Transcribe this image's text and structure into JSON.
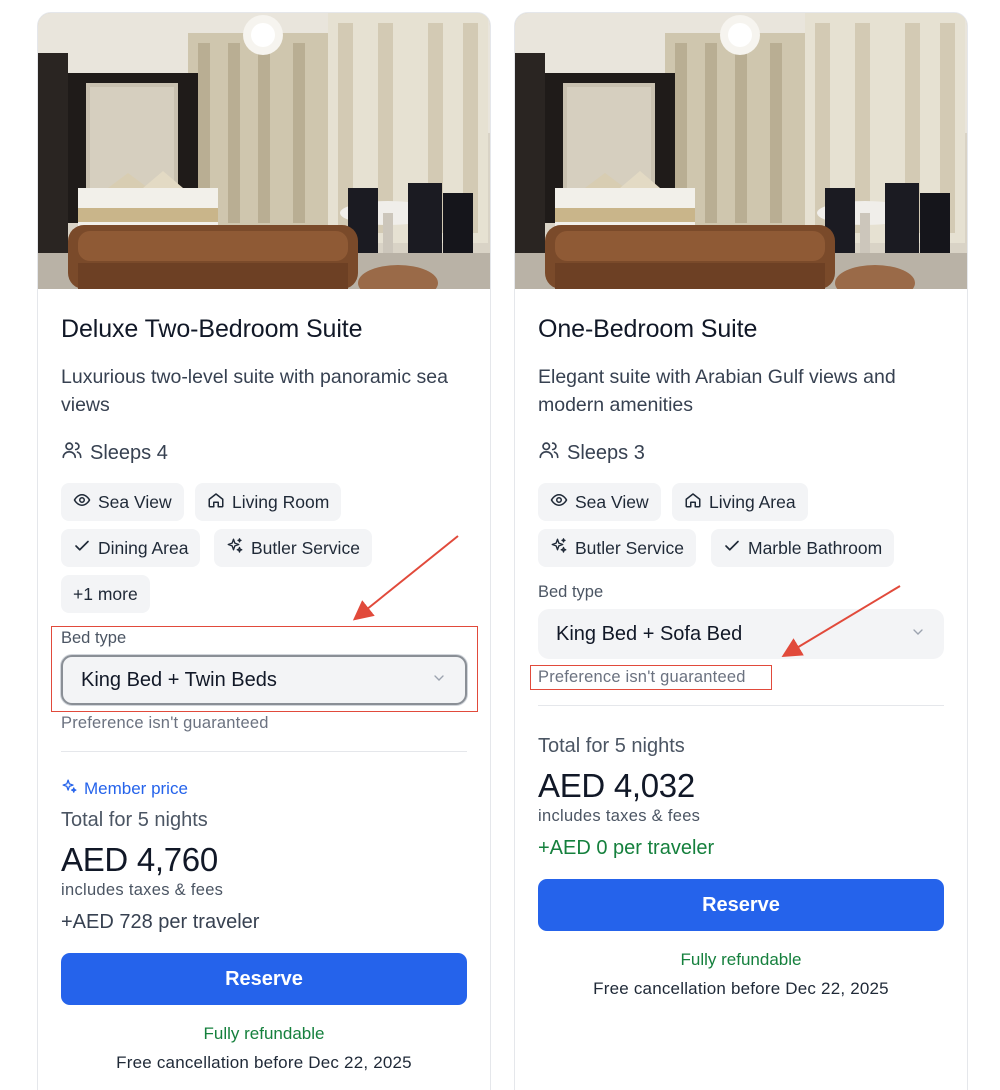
{
  "cards": [
    {
      "title": "Deluxe Two-Bedroom Suite",
      "description": "Luxurious two-level suite with panoramic sea views",
      "sleeps": "Sleeps 4",
      "amenities": [
        "Sea View",
        "Living Room",
        "Dining Area",
        "Butler Service",
        "+1 more"
      ],
      "bed_type_label": "Bed type",
      "bed_type_value": "King Bed + Twin Beds",
      "preference_note": "Preference isn't guaranteed",
      "member_price": "Member price",
      "total_label": "Total for 5 nights",
      "price": "AED 4,760",
      "taxes": "includes taxes & fees",
      "per_traveler": "+AED 728 per traveler",
      "reserve_label": "Reserve",
      "refund": "Fully refundable",
      "cancellation": "Free cancellation before Dec 22, 2025"
    },
    {
      "title": "One-Bedroom Suite",
      "description": "Elegant suite with Arabian Gulf views and modern amenities",
      "sleeps": "Sleeps 3",
      "amenities": [
        "Sea View",
        "Living Area",
        "Butler Service",
        "Marble Bathroom"
      ],
      "bed_type_label": "Bed type",
      "bed_type_value": "King Bed + Sofa Bed",
      "preference_note": "Preference isn't guaranteed",
      "total_label": "Total for 5 nights",
      "price": "AED 4,032",
      "taxes": "includes taxes & fees",
      "per_traveler": "+AED 0 per traveler",
      "reserve_label": "Reserve",
      "refund": "Fully refundable",
      "cancellation": "Free cancellation before Dec 22, 2025"
    }
  ],
  "colors": {
    "accent": "#2563eb",
    "success": "#15803d",
    "annotation": "#e14a3b",
    "chip_bg": "#f3f4f6"
  },
  "icons": [
    "users-icon",
    "eye-icon",
    "home-icon",
    "check-icon",
    "sparkle-icon",
    "chevron-down-icon"
  ]
}
